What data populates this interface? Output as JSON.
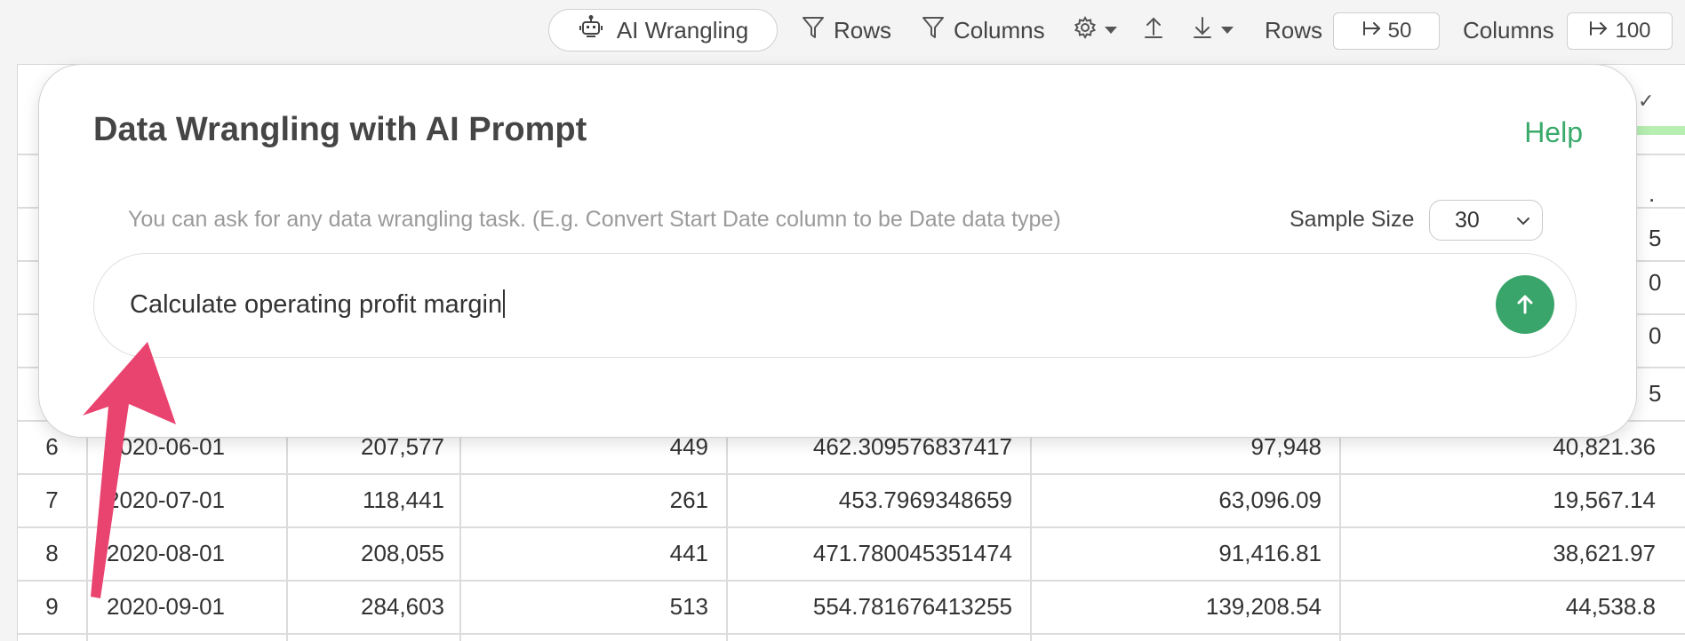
{
  "toolbar": {
    "ai_wrangling": "AI Wrangling",
    "rows_filter": "Rows",
    "columns_filter": "Columns",
    "rows_label": "Rows",
    "rows_value": "50",
    "columns_label": "Columns",
    "columns_value": "100"
  },
  "dialog": {
    "title": "Data Wrangling with AI Prompt",
    "help": "Help",
    "hint": "You can ask for any data wrangling task. (E.g. Convert Start Date column to be Date data type)",
    "sample_size_label": "Sample Size",
    "sample_size_value": "30",
    "prompt_value": "Calculate operating profit margin"
  },
  "table": {
    "rows": [
      {
        "n": "6",
        "date": "2020-06-01",
        "c1": "207,577",
        "c2": "449",
        "c3": "462.309576837417",
        "c4": "97,948",
        "c5": "40,821.36"
      },
      {
        "n": "7",
        "date": "2020-07-01",
        "c1": "118,441",
        "c2": "261",
        "c3": "453.7969348659",
        "c4": "63,096.09",
        "c5": "19,567.14"
      },
      {
        "n": "8",
        "date": "2020-08-01",
        "c1": "208,055",
        "c2": "441",
        "c3": "471.780045351474",
        "c4": "91,416.81",
        "c5": "38,621.97"
      },
      {
        "n": "9",
        "date": "2020-09-01",
        "c1": "284,603",
        "c2": "513",
        "c3": "554.781676413255",
        "c4": "139,208.54",
        "c5": "44,538.8"
      }
    ]
  },
  "colors": {
    "accent_green": "#3aa56a",
    "annotation_arrow": "#e9436f"
  }
}
